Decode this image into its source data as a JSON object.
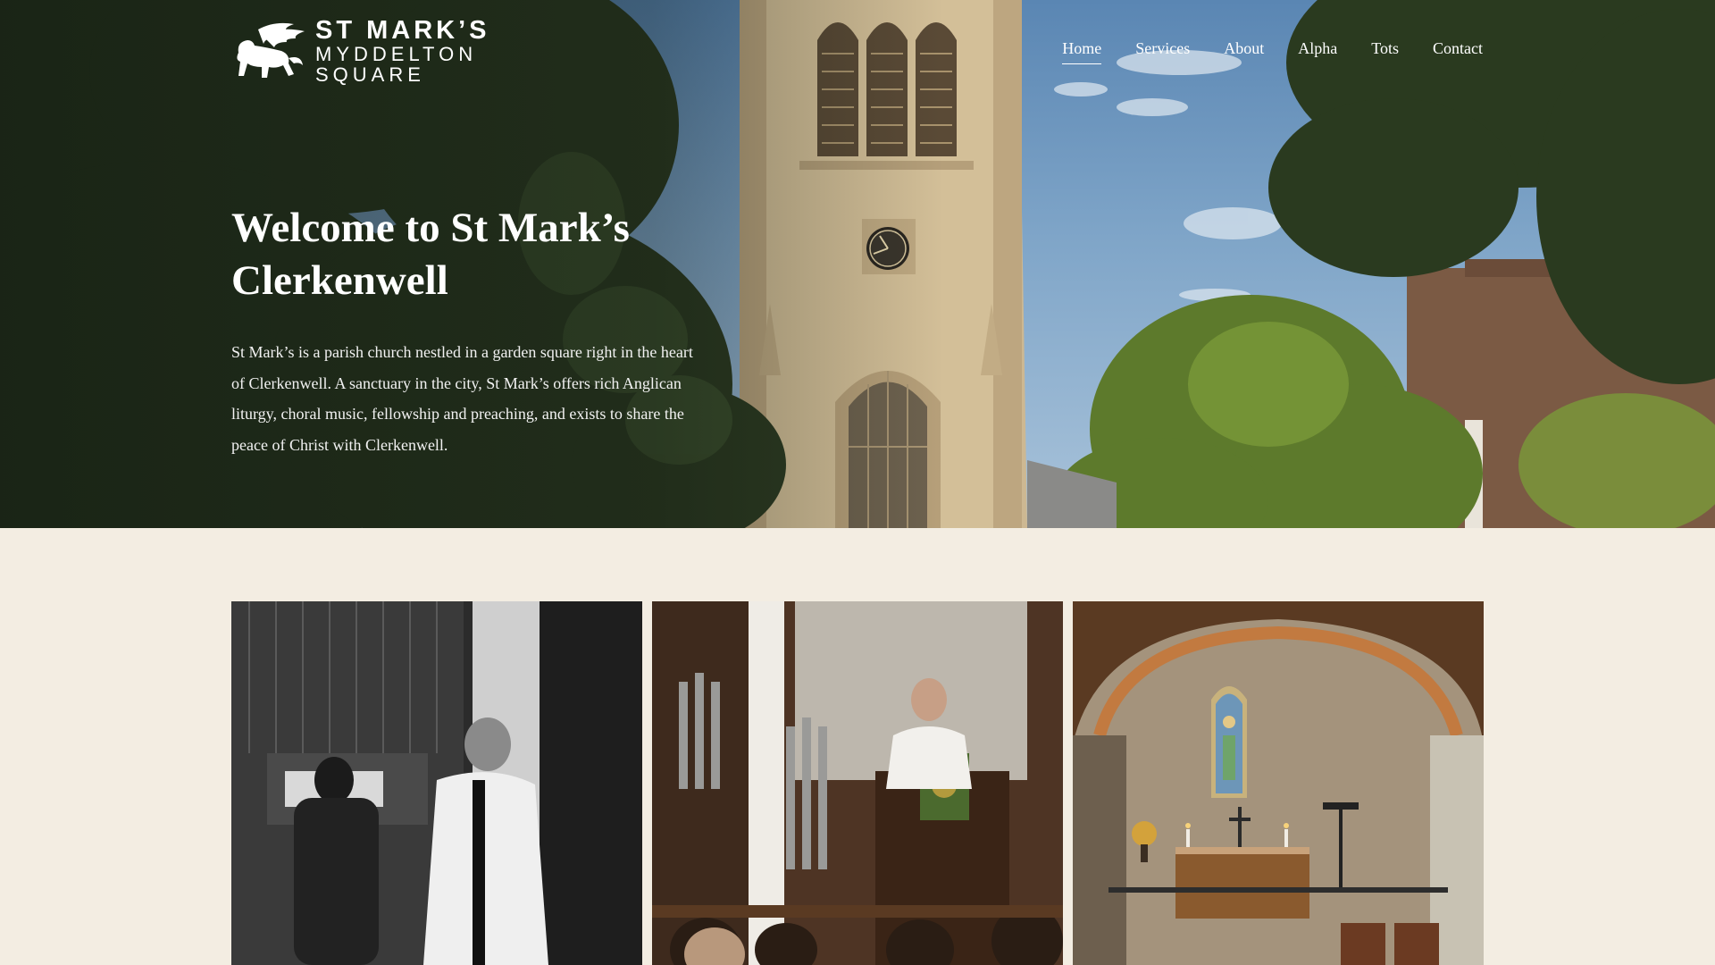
{
  "site": {
    "logo": {
      "line1": "ST MARK’S",
      "line2": "MYDDELTON",
      "line3": "SQUARE"
    }
  },
  "nav": {
    "items": [
      {
        "label": "Home",
        "active": true
      },
      {
        "label": "Services",
        "active": false
      },
      {
        "label": "About",
        "active": false
      },
      {
        "label": "Alpha",
        "active": false
      },
      {
        "label": "Tots",
        "active": false
      },
      {
        "label": "Contact",
        "active": false
      }
    ]
  },
  "hero": {
    "title_line1": "Welcome to St Mark’s",
    "title_line2": "Clerkenwell",
    "intro": "St Mark’s is a parish church nestled in a garden square right in the heart of Clerkenwell. A sanctuary in the city, St Mark’s offers rich Anglican liturgy, choral music, fellowship and preaching, and exists to share the peace of Christ with Clerkenwell."
  },
  "gallery": {
    "photos": [
      {
        "subject": "organist-and-clergy-photo"
      },
      {
        "subject": "pulpit-preaching-photo"
      },
      {
        "subject": "side-chapel-altar-photo"
      }
    ]
  },
  "colors": {
    "page_background": "#f3ede2",
    "text_light": "#ffffff",
    "foliage": "#2d3b22",
    "stone": "#cdb892"
  }
}
